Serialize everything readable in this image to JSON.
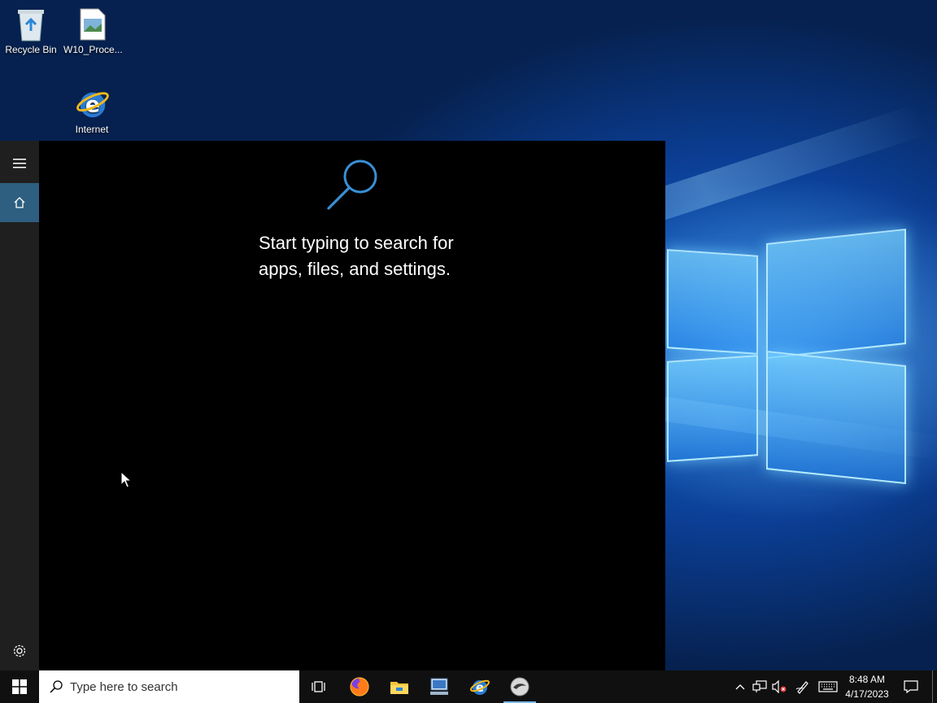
{
  "desktop": {
    "icons": [
      {
        "label": "Recycle Bin"
      },
      {
        "label": "W10_Proce..."
      },
      {
        "label": "Internet"
      }
    ]
  },
  "start": {
    "search_hint": "Start typing to search for apps, files, and settings.",
    "rail": {
      "menu": "hamburger-menu-icon",
      "home": "home-icon",
      "settings": "gear-icon"
    }
  },
  "taskbar": {
    "search_placeholder": "Type here to search",
    "apps": [
      "firefox",
      "file-explorer",
      "network-computer",
      "internet-explorer",
      "steam-like-app"
    ],
    "clock": {
      "time": "8:48 AM",
      "date": "4/17/2023"
    }
  },
  "colors": {
    "rail": "#1f1f1f",
    "home_active": "#2e5f80",
    "accent": "#3a8fd6"
  }
}
